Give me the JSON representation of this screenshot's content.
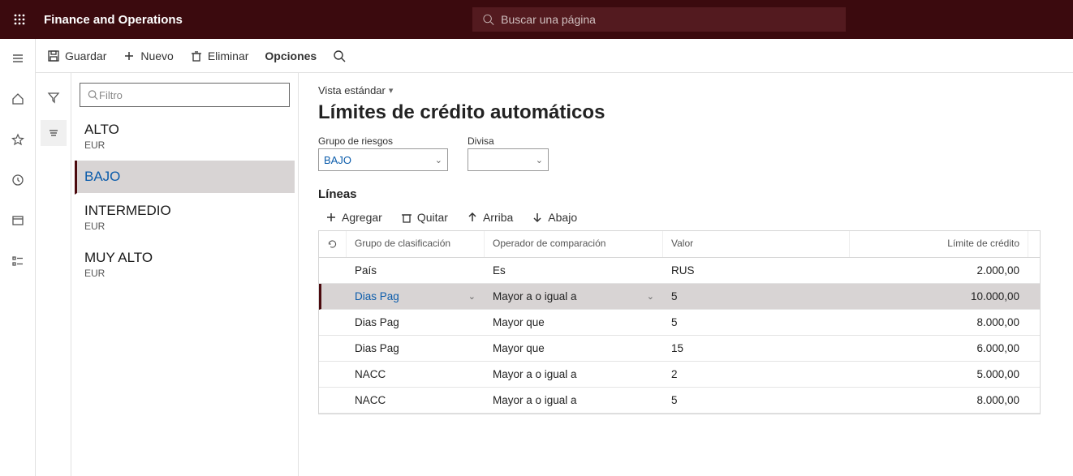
{
  "header": {
    "app_title": "Finance and Operations",
    "search_placeholder": "Buscar una página"
  },
  "toolbar": {
    "save": "Guardar",
    "new": "Nuevo",
    "delete": "Eliminar",
    "options": "Opciones"
  },
  "listFilter": {
    "placeholder": "Filtro"
  },
  "groups": [
    {
      "title": "ALTO",
      "sub": "EUR",
      "selected": false
    },
    {
      "title": "BAJO",
      "sub": "",
      "selected": true
    },
    {
      "title": "INTERMEDIO",
      "sub": "EUR",
      "selected": false
    },
    {
      "title": "MUY ALTO",
      "sub": "EUR",
      "selected": false
    }
  ],
  "main": {
    "view": "Vista estándar",
    "heading": "Límites de crédito automáticos",
    "fields": {
      "riskGroupLabel": "Grupo de riesgos",
      "riskGroupValue": "BAJO",
      "currencyLabel": "Divisa",
      "currencyValue": ""
    },
    "sectionTitle": "Líneas",
    "gridToolbar": {
      "add": "Agregar",
      "remove": "Quitar",
      "up": "Arriba",
      "down": "Abajo"
    },
    "gridHeaders": {
      "class": "Grupo de clasificación",
      "op": "Operador de comparación",
      "val": "Valor",
      "lim": "Límite de crédito"
    },
    "rows": [
      {
        "class": "País",
        "op": "Es",
        "val": "RUS",
        "lim": "2.000,00",
        "selected": false
      },
      {
        "class": "Dias Pag",
        "op": "Mayor a o igual a",
        "val": "5",
        "lim": "10.000,00",
        "selected": true
      },
      {
        "class": "Dias Pag",
        "op": "Mayor que",
        "val": "5",
        "lim": "8.000,00",
        "selected": false
      },
      {
        "class": "Dias Pag",
        "op": "Mayor que",
        "val": "15",
        "lim": "6.000,00",
        "selected": false
      },
      {
        "class": "NACC",
        "op": "Mayor a o igual a",
        "val": "2",
        "lim": "5.000,00",
        "selected": false
      },
      {
        "class": "NACC",
        "op": "Mayor a o igual a",
        "val": "5",
        "lim": "8.000,00",
        "selected": false
      }
    ]
  }
}
